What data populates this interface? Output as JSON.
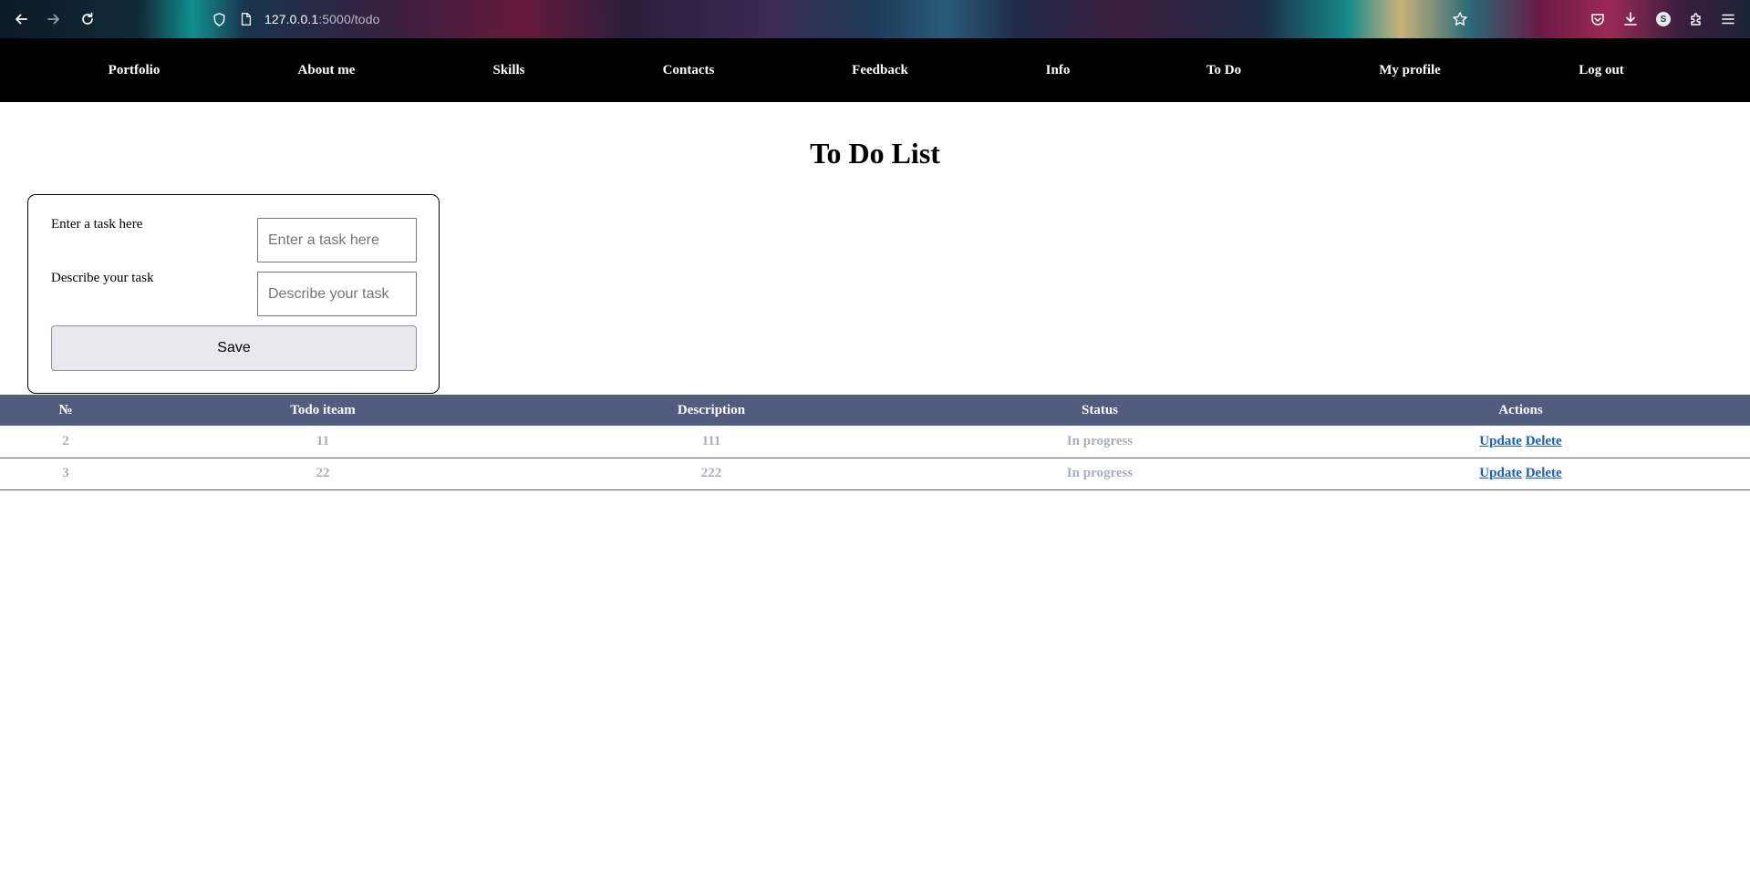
{
  "browser": {
    "url_host": "127.0.0.1",
    "url_rest": ":5000/todo",
    "profile_initial": "S"
  },
  "nav": {
    "items": [
      "Portfolio",
      "About me",
      "Skills",
      "Contacts",
      "Feedback",
      "Info",
      "To Do",
      "My profile",
      "Log out"
    ]
  },
  "page": {
    "title": "To Do List"
  },
  "form": {
    "task_label": "Enter a task here",
    "task_placeholder": "Enter a task here",
    "description_label": "Describe your task",
    "description_placeholder": "Describe your task",
    "save_label": "Save"
  },
  "table": {
    "headers": [
      "№",
      "Todo iteam",
      "Description",
      "Status",
      "Actions"
    ],
    "rows": [
      {
        "num": "2",
        "item": "11",
        "description": "111",
        "status": "In progress",
        "update": "Update",
        "delete": "Delete"
      },
      {
        "num": "3",
        "item": "22",
        "description": "222",
        "status": "In progress",
        "update": "Update",
        "delete": "Delete"
      }
    ]
  },
  "colors": {
    "nav_bg": "#000000",
    "table_header_bg": "#525c7e",
    "cell_text": "#a9aebc",
    "link": "#1a5fb4"
  }
}
